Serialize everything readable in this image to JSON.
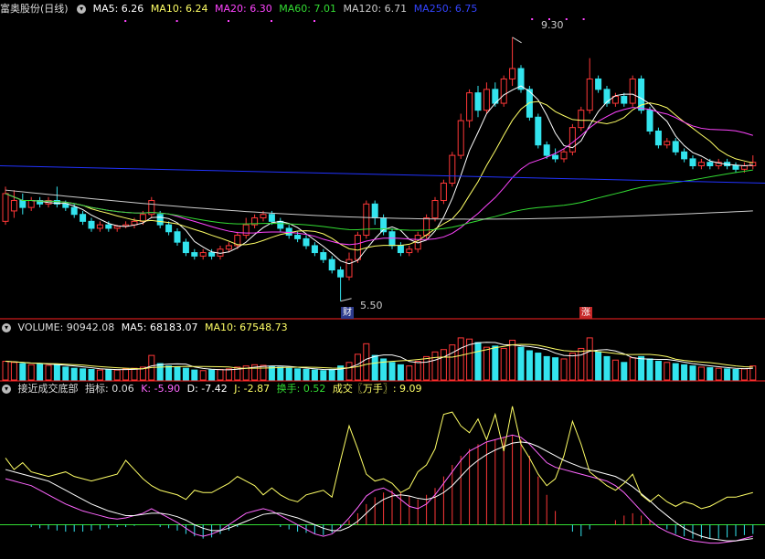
{
  "colors": {
    "up": "#ff3838",
    "down": "#33e4ee",
    "ma5": "#ffffff",
    "ma10": "#ffff66",
    "ma20": "#ff44ff",
    "ma60": "#33dd33",
    "ma120": "#cccccc",
    "ma250": "#2233ff",
    "divider": "#ff2222",
    "k": "#ff66ff",
    "d": "#ffffff",
    "j": "#ffff66",
    "green": "#33dd33"
  },
  "price_panel": {
    "stock_title": "富奥股份(日线)",
    "ma5": "MA5: 6.26",
    "ma10": "MA10: 6.24",
    "ma20": "MA20: 6.30",
    "ma60": "MA60: 7.01",
    "ma120": "MA120: 6.71",
    "ma250": "MA250: 6.75",
    "high_label": "9.30",
    "low_label": "5.50",
    "marker_cai": "财",
    "marker_zhang": "涨"
  },
  "volume_panel": {
    "volume": "VOLUME: 90942.08",
    "ma5": "MA5: 68183.07",
    "ma10": "MA10: 67548.73"
  },
  "indicator_panel": {
    "name": "接近成交底部",
    "metric": "指标: 0.06",
    "k": "K: -5.90",
    "d": "D: -7.42",
    "j": "J: -2.87",
    "turnover": "换手: 0.52",
    "deal": "成交〖万手〗: 9.09"
  },
  "chart_data": {
    "type": "candlestick",
    "price_ylim": [
      5.3,
      9.6
    ],
    "candles": [
      [
        6.65,
        7.05,
        7.15,
        6.6
      ],
      [
        6.8,
        6.95,
        7.1,
        6.7
      ],
      [
        6.95,
        6.85,
        7.05,
        6.75
      ],
      [
        6.85,
        6.95,
        7.0,
        6.8
      ],
      [
        6.95,
        6.9,
        7.0,
        6.85
      ],
      [
        6.9,
        6.95,
        7.0,
        6.85
      ],
      [
        6.95,
        6.9,
        7.15,
        6.85
      ],
      [
        6.9,
        6.85,
        6.95,
        6.8
      ],
      [
        6.85,
        6.75,
        6.9,
        6.7
      ],
      [
        6.75,
        6.65,
        6.8,
        6.6
      ],
      [
        6.65,
        6.55,
        6.7,
        6.5
      ],
      [
        6.55,
        6.6,
        6.65,
        6.5
      ],
      [
        6.6,
        6.55,
        6.65,
        6.5
      ],
      [
        6.55,
        6.58,
        6.6,
        6.5
      ],
      [
        6.58,
        6.6,
        6.65,
        6.55
      ],
      [
        6.6,
        6.65,
        6.7,
        6.55
      ],
      [
        6.65,
        6.75,
        6.8,
        6.6
      ],
      [
        6.75,
        6.95,
        7.0,
        6.7
      ],
      [
        6.75,
        6.6,
        6.8,
        6.55
      ],
      [
        6.6,
        6.5,
        6.65,
        6.45
      ],
      [
        6.5,
        6.35,
        6.55,
        6.3
      ],
      [
        6.35,
        6.2,
        6.4,
        6.15
      ],
      [
        6.2,
        6.15,
        6.25,
        6.1
      ],
      [
        6.15,
        6.2,
        6.25,
        6.1
      ],
      [
        6.2,
        6.15,
        6.25,
        6.1
      ],
      [
        6.15,
        6.25,
        6.3,
        6.1
      ],
      [
        6.25,
        6.3,
        6.35,
        6.2
      ],
      [
        6.3,
        6.45,
        6.5,
        6.25
      ],
      [
        6.45,
        6.6,
        6.7,
        6.4
      ],
      [
        6.6,
        6.7,
        6.75,
        6.55
      ],
      [
        6.7,
        6.75,
        6.8,
        6.65
      ],
      [
        6.75,
        6.65,
        6.8,
        6.6
      ],
      [
        6.65,
        6.55,
        6.7,
        6.5
      ],
      [
        6.55,
        6.45,
        6.6,
        6.4
      ],
      [
        6.45,
        6.4,
        6.5,
        6.35
      ],
      [
        6.4,
        6.3,
        6.45,
        6.25
      ],
      [
        6.3,
        6.2,
        6.35,
        6.15
      ],
      [
        6.2,
        6.1,
        6.25,
        6.05
      ],
      [
        6.1,
        5.95,
        6.15,
        5.9
      ],
      [
        5.95,
        5.85,
        6.0,
        5.5
      ],
      [
        5.85,
        6.1,
        6.2,
        5.8
      ],
      [
        6.1,
        6.45,
        6.5,
        6.05
      ],
      [
        6.45,
        6.9,
        6.95,
        6.4
      ],
      [
        6.9,
        6.7,
        6.95,
        6.6
      ],
      [
        6.7,
        6.5,
        6.75,
        6.45
      ],
      [
        6.5,
        6.3,
        6.55,
        6.25
      ],
      [
        6.3,
        6.2,
        6.35,
        6.15
      ],
      [
        6.2,
        6.25,
        6.3,
        6.15
      ],
      [
        6.25,
        6.45,
        6.5,
        6.2
      ],
      [
        6.45,
        6.7,
        6.75,
        6.4
      ],
      [
        6.7,
        6.95,
        7.0,
        6.65
      ],
      [
        6.95,
        7.2,
        7.25,
        6.9
      ],
      [
        7.2,
        7.6,
        7.65,
        7.15
      ],
      [
        7.6,
        8.1,
        8.2,
        7.55
      ],
      [
        8.1,
        8.5,
        8.55,
        8.0
      ],
      [
        8.5,
        8.25,
        8.6,
        8.15
      ],
      [
        8.25,
        8.55,
        8.65,
        8.2
      ],
      [
        8.55,
        8.35,
        8.65,
        8.3
      ],
      [
        8.35,
        8.7,
        8.75,
        8.3
      ],
      [
        8.7,
        8.85,
        9.3,
        8.6
      ],
      [
        8.85,
        8.55,
        8.9,
        8.5
      ],
      [
        8.55,
        8.15,
        8.6,
        8.1
      ],
      [
        8.15,
        7.75,
        8.2,
        7.7
      ],
      [
        7.75,
        7.6,
        7.8,
        7.55
      ],
      [
        7.6,
        7.55,
        7.7,
        7.5
      ],
      [
        7.55,
        7.65,
        7.7,
        7.5
      ],
      [
        7.65,
        8.0,
        8.05,
        7.6
      ],
      [
        8.0,
        8.25,
        8.3,
        7.95
      ],
      [
        8.25,
        8.7,
        9.0,
        8.2
      ],
      [
        8.7,
        8.55,
        8.75,
        8.5
      ],
      [
        8.55,
        8.35,
        8.6,
        8.3
      ],
      [
        8.35,
        8.45,
        8.5,
        8.3
      ],
      [
        8.45,
        8.35,
        8.5,
        8.3
      ],
      [
        8.35,
        8.7,
        8.75,
        8.3
      ],
      [
        8.7,
        8.25,
        8.75,
        8.2
      ],
      [
        8.25,
        7.95,
        8.3,
        7.9
      ],
      [
        7.95,
        7.75,
        8.0,
        7.7
      ],
      [
        7.75,
        7.8,
        7.85,
        7.7
      ],
      [
        7.8,
        7.65,
        7.85,
        7.6
      ],
      [
        7.65,
        7.55,
        7.7,
        7.5
      ],
      [
        7.55,
        7.45,
        7.6,
        7.4
      ],
      [
        7.45,
        7.5,
        7.55,
        7.4
      ],
      [
        7.5,
        7.45,
        7.55,
        7.4
      ],
      [
        7.45,
        7.5,
        7.55,
        7.4
      ],
      [
        7.5,
        7.45,
        7.55,
        7.4
      ],
      [
        7.45,
        7.4,
        7.5,
        7.35
      ],
      [
        7.4,
        7.45,
        7.5,
        7.35
      ],
      [
        7.45,
        7.5,
        7.6,
        7.4
      ]
    ],
    "volume_ylim": [
      0,
      75000
    ],
    "volumes": [
      32000,
      30000,
      28000,
      26000,
      27000,
      25000,
      26000,
      22000,
      20000,
      19000,
      18000,
      17000,
      18000,
      17000,
      19000,
      20000,
      22000,
      42000,
      28000,
      24000,
      22000,
      20000,
      17000,
      16000,
      17000,
      18000,
      19000,
      22000,
      24000,
      26000,
      25000,
      23000,
      22000,
      20000,
      19000,
      18000,
      17000,
      16000,
      18000,
      24000,
      30000,
      44000,
      62000,
      42000,
      36000,
      30000,
      26000,
      24000,
      32000,
      40000,
      48000,
      52000,
      60000,
      72000,
      70000,
      64000,
      56000,
      58000,
      54000,
      68000,
      56000,
      50000,
      46000,
      40000,
      38000,
      36000,
      46000,
      54000,
      72000,
      48000,
      40000,
      34000,
      30000,
      38000,
      40000,
      36000,
      32000,
      30000,
      28000,
      26000,
      24000,
      22000,
      21000,
      20000,
      19000,
      18000,
      19000,
      24000
    ],
    "indicator_ylim": [
      -25,
      110
    ],
    "k": [
      40,
      38,
      36,
      34,
      30,
      26,
      22,
      18,
      15,
      12,
      10,
      8,
      6,
      5,
      6,
      8,
      10,
      14,
      10,
      6,
      2,
      -3,
      -8,
      -10,
      -8,
      -5,
      0,
      5,
      10,
      12,
      14,
      12,
      8,
      4,
      0,
      -4,
      -8,
      -10,
      -8,
      -2,
      6,
      15,
      25,
      30,
      32,
      28,
      22,
      16,
      14,
      18,
      26,
      36,
      46,
      56,
      64,
      68,
      72,
      74,
      76,
      78,
      76,
      70,
      62,
      54,
      50,
      48,
      46,
      44,
      42,
      40,
      38,
      34,
      28,
      20,
      12,
      4,
      -2,
      -6,
      -9,
      -12,
      -14,
      -15,
      -16,
      -16,
      -15,
      -14,
      -12,
      -10
    ],
    "d": [
      48,
      46,
      44,
      42,
      40,
      38,
      34,
      30,
      26,
      22,
      18,
      15,
      12,
      10,
      8,
      8,
      9,
      10,
      10,
      9,
      7,
      4,
      0,
      -3,
      -5,
      -5,
      -3,
      0,
      3,
      6,
      9,
      10,
      10,
      8,
      6,
      3,
      0,
      -3,
      -5,
      -5,
      -2,
      3,
      10,
      17,
      22,
      25,
      26,
      25,
      23,
      22,
      24,
      28,
      34,
      42,
      50,
      56,
      61,
      65,
      68,
      71,
      72,
      71,
      68,
      64,
      60,
      56,
      53,
      50,
      48,
      46,
      44,
      42,
      38,
      33,
      27,
      21,
      14,
      8,
      2,
      -3,
      -7,
      -10,
      -12,
      -13,
      -14,
      -14,
      -13,
      -12
    ],
    "j": [
      58,
      48,
      54,
      46,
      44,
      42,
      44,
      46,
      42,
      40,
      38,
      40,
      42,
      44,
      56,
      48,
      40,
      34,
      30,
      28,
      26,
      22,
      30,
      28,
      28,
      32,
      36,
      42,
      38,
      34,
      26,
      32,
      26,
      22,
      20,
      26,
      28,
      30,
      24,
      56,
      86,
      66,
      44,
      38,
      40,
      36,
      28,
      32,
      46,
      52,
      66,
      96,
      98,
      86,
      80,
      92,
      74,
      96,
      64,
      103,
      70,
      58,
      44,
      34,
      40,
      60,
      90,
      70,
      46,
      40,
      34,
      30,
      36,
      44,
      26,
      20,
      26,
      20,
      16,
      20,
      18,
      14,
      16,
      20,
      24,
      24,
      26,
      28
    ],
    "bars": [
      0,
      0,
      0,
      -2,
      -3,
      -4,
      -5,
      -6,
      -6,
      -6,
      -5,
      -4,
      -3,
      -2,
      -2,
      -1,
      0,
      0,
      -2,
      -3,
      -5,
      -8,
      -10,
      -12,
      -11,
      -8,
      -5,
      -2,
      0,
      0,
      0,
      0,
      -2,
      -4,
      -6,
      -7,
      -8,
      -9,
      -7,
      -3,
      4,
      10,
      18,
      24,
      28,
      30,
      28,
      25,
      22,
      26,
      32,
      42,
      52,
      60,
      66,
      70,
      72,
      74,
      76,
      78,
      74,
      60,
      42,
      26,
      12,
      0,
      -6,
      -10,
      -4,
      0,
      0,
      4,
      8,
      10,
      8,
      4,
      0,
      -4,
      -8,
      -10,
      -12,
      -12,
      -12,
      -12,
      -11,
      -10,
      -9,
      -8
    ],
    "ma_lines": {
      "ma250": [
        [
          7.45,
          7.2
        ]
      ],
      "ma120": [
        [
          7.1,
          6.8
        ]
      ]
    }
  }
}
